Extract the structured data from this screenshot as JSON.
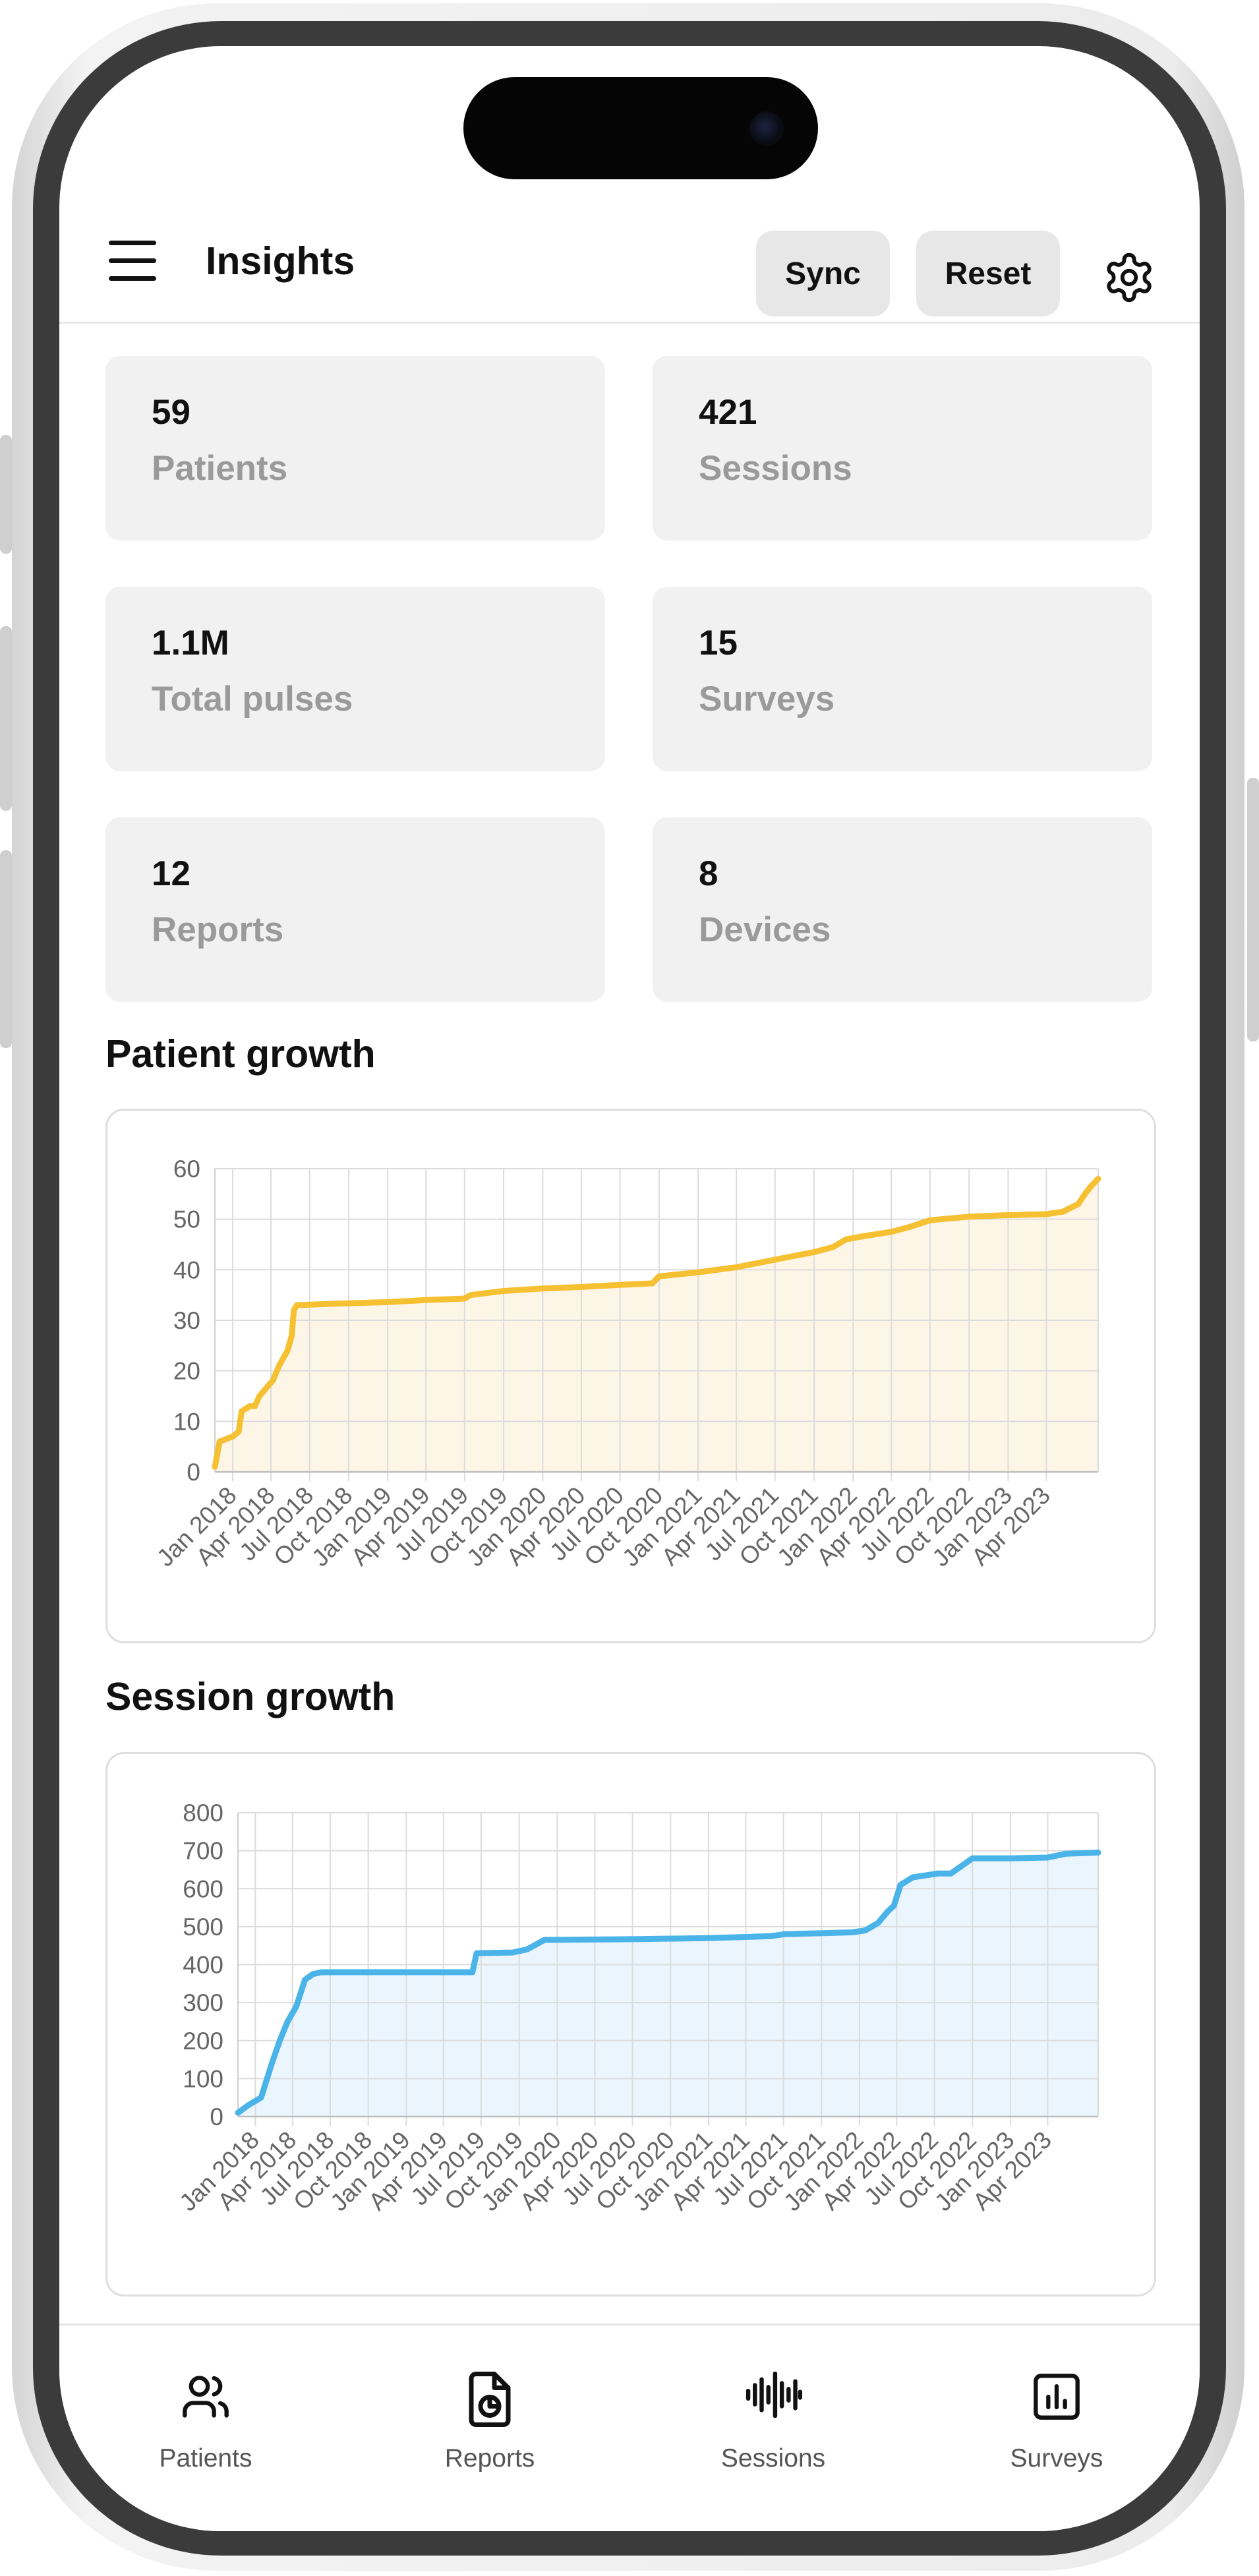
{
  "app": {
    "title": "Insights",
    "buttons": {
      "sync": "Sync",
      "reset": "Reset"
    }
  },
  "stats": [
    {
      "value": "59",
      "label": "Patients"
    },
    {
      "value": "421",
      "label": "Sessions"
    },
    {
      "value": "1.1M",
      "label": "Total pulses"
    },
    {
      "value": "15",
      "label": "Surveys"
    },
    {
      "value": "12",
      "label": "Reports"
    },
    {
      "value": "8",
      "label": "Devices"
    }
  ],
  "sections": {
    "patient_growth": "Patient growth",
    "session_growth": "Session growth"
  },
  "nav": [
    {
      "label": "Patients",
      "icon": "users-icon"
    },
    {
      "label": "Reports",
      "icon": "file-chart-icon"
    },
    {
      "label": "Sessions",
      "icon": "waveform-icon"
    },
    {
      "label": "Surveys",
      "icon": "bar-chart-icon"
    }
  ],
  "colors": {
    "patient_line": "#f5c132",
    "patient_fill": "#fdf6e7",
    "session_line": "#4ab3e8",
    "session_fill": "#eaf5fd",
    "card_bg": "#f1f1f1"
  },
  "chart_data": [
    {
      "type": "area",
      "xlabel": "",
      "ylabel": "",
      "ylim": [
        0,
        60
      ],
      "yticks": [
        0,
        10,
        20,
        30,
        40,
        50,
        60
      ],
      "xtick_labels": [
        "Jan 2018",
        "Apr 2018",
        "Jul 2018",
        "Oct 2018",
        "Jan 2019",
        "Apr 2019",
        "Jul 2019",
        "Oct 2019",
        "Jan 2020",
        "Apr 2020",
        "Jul 2020",
        "Oct 2020",
        "Jan 2021",
        "Apr 2021",
        "Jul 2021",
        "Oct 2021",
        "Jan 2022",
        "Apr 2022",
        "Jul 2022",
        "Oct 2022",
        "Jan 2023",
        "Apr 2023"
      ],
      "grid": true,
      "x": [
        "2017-11-20",
        "2017-12-01",
        "2018-01-01",
        "2018-01-15",
        "2018-01-22",
        "2018-02-10",
        "2018-02-22",
        "2018-03-05",
        "2018-03-15",
        "2018-03-25",
        "2018-04-05",
        "2018-04-20",
        "2018-05-10",
        "2018-05-20",
        "2018-05-25",
        "2018-06-01",
        "2018-09-01",
        "2019-01-01",
        "2019-04-01",
        "2019-07-01",
        "2019-07-15",
        "2019-10-01",
        "2020-01-01",
        "2020-04-01",
        "2020-07-01",
        "2020-09-15",
        "2020-10-01",
        "2021-01-01",
        "2021-04-01",
        "2021-07-01",
        "2021-10-01",
        "2021-11-15",
        "2021-12-15",
        "2022-01-15",
        "2022-04-01",
        "2022-05-15",
        "2022-07-01",
        "2022-10-01",
        "2023-01-01",
        "2023-04-01",
        "2023-05-10",
        "2023-06-15",
        "2023-07-01",
        "2023-07-15",
        "2023-08-01"
      ],
      "series": [
        {
          "values": [
            1,
            6,
            7,
            8,
            12,
            13,
            13,
            15,
            16,
            17,
            18,
            21,
            24,
            27,
            32,
            33,
            33.3,
            33.6,
            34,
            34.3,
            35,
            35.8,
            36.3,
            36.6,
            37,
            37.3,
            38.7,
            39.5,
            40.5,
            42,
            43.5,
            44.5,
            46,
            46.5,
            47.5,
            48.5,
            49.8,
            50.5,
            50.8,
            51,
            51.5,
            53,
            55,
            56.5,
            58
          ]
        }
      ]
    },
    {
      "type": "area",
      "xlabel": "",
      "ylabel": "",
      "ylim": [
        0,
        800
      ],
      "yticks": [
        0,
        100,
        200,
        300,
        400,
        500,
        600,
        700,
        800
      ],
      "xtick_labels": [
        "Jan 2018",
        "Apr 2018",
        "Jul 2018",
        "Oct 2018",
        "Jan 2019",
        "Apr 2019",
        "Jul 2019",
        "Oct 2019",
        "Jan 2020",
        "Apr 2020",
        "Jul 2020",
        "Oct 2020",
        "Jan 2021",
        "Apr 2021",
        "Jul 2021",
        "Oct 2021",
        "Jan 2022",
        "Apr 2022",
        "Jul 2022",
        "Oct 2022",
        "Jan 2023",
        "Apr 2023"
      ],
      "grid": true,
      "x": [
        "2017-11-20",
        "2017-12-15",
        "2018-01-15",
        "2018-02-10",
        "2018-03-01",
        "2018-03-20",
        "2018-04-10",
        "2018-05-01",
        "2018-05-20",
        "2018-06-10",
        "2018-07-01",
        "2018-10-01",
        "2019-01-01",
        "2019-04-01",
        "2019-06-10",
        "2019-06-20",
        "2019-09-15",
        "2019-10-20",
        "2019-12-01",
        "2020-07-01",
        "2021-01-01",
        "2021-06-01",
        "2021-07-01",
        "2021-12-15",
        "2022-01-15",
        "2022-02-15",
        "2022-03-10",
        "2022-03-25",
        "2022-04-10",
        "2022-05-10",
        "2022-07-10",
        "2022-08-10",
        "2022-10-01",
        "2023-01-01",
        "2023-04-01",
        "2023-05-15",
        "2023-08-01"
      ],
      "series": [
        {
          "values": [
            10,
            30,
            50,
            140,
            200,
            250,
            290,
            360,
            375,
            380,
            380,
            380,
            380,
            380,
            380,
            430,
            432,
            440,
            465,
            467,
            470,
            475,
            480,
            485,
            490,
            510,
            540,
            555,
            610,
            630,
            640,
            640,
            680,
            680,
            682,
            692,
            695
          ]
        }
      ]
    }
  ]
}
